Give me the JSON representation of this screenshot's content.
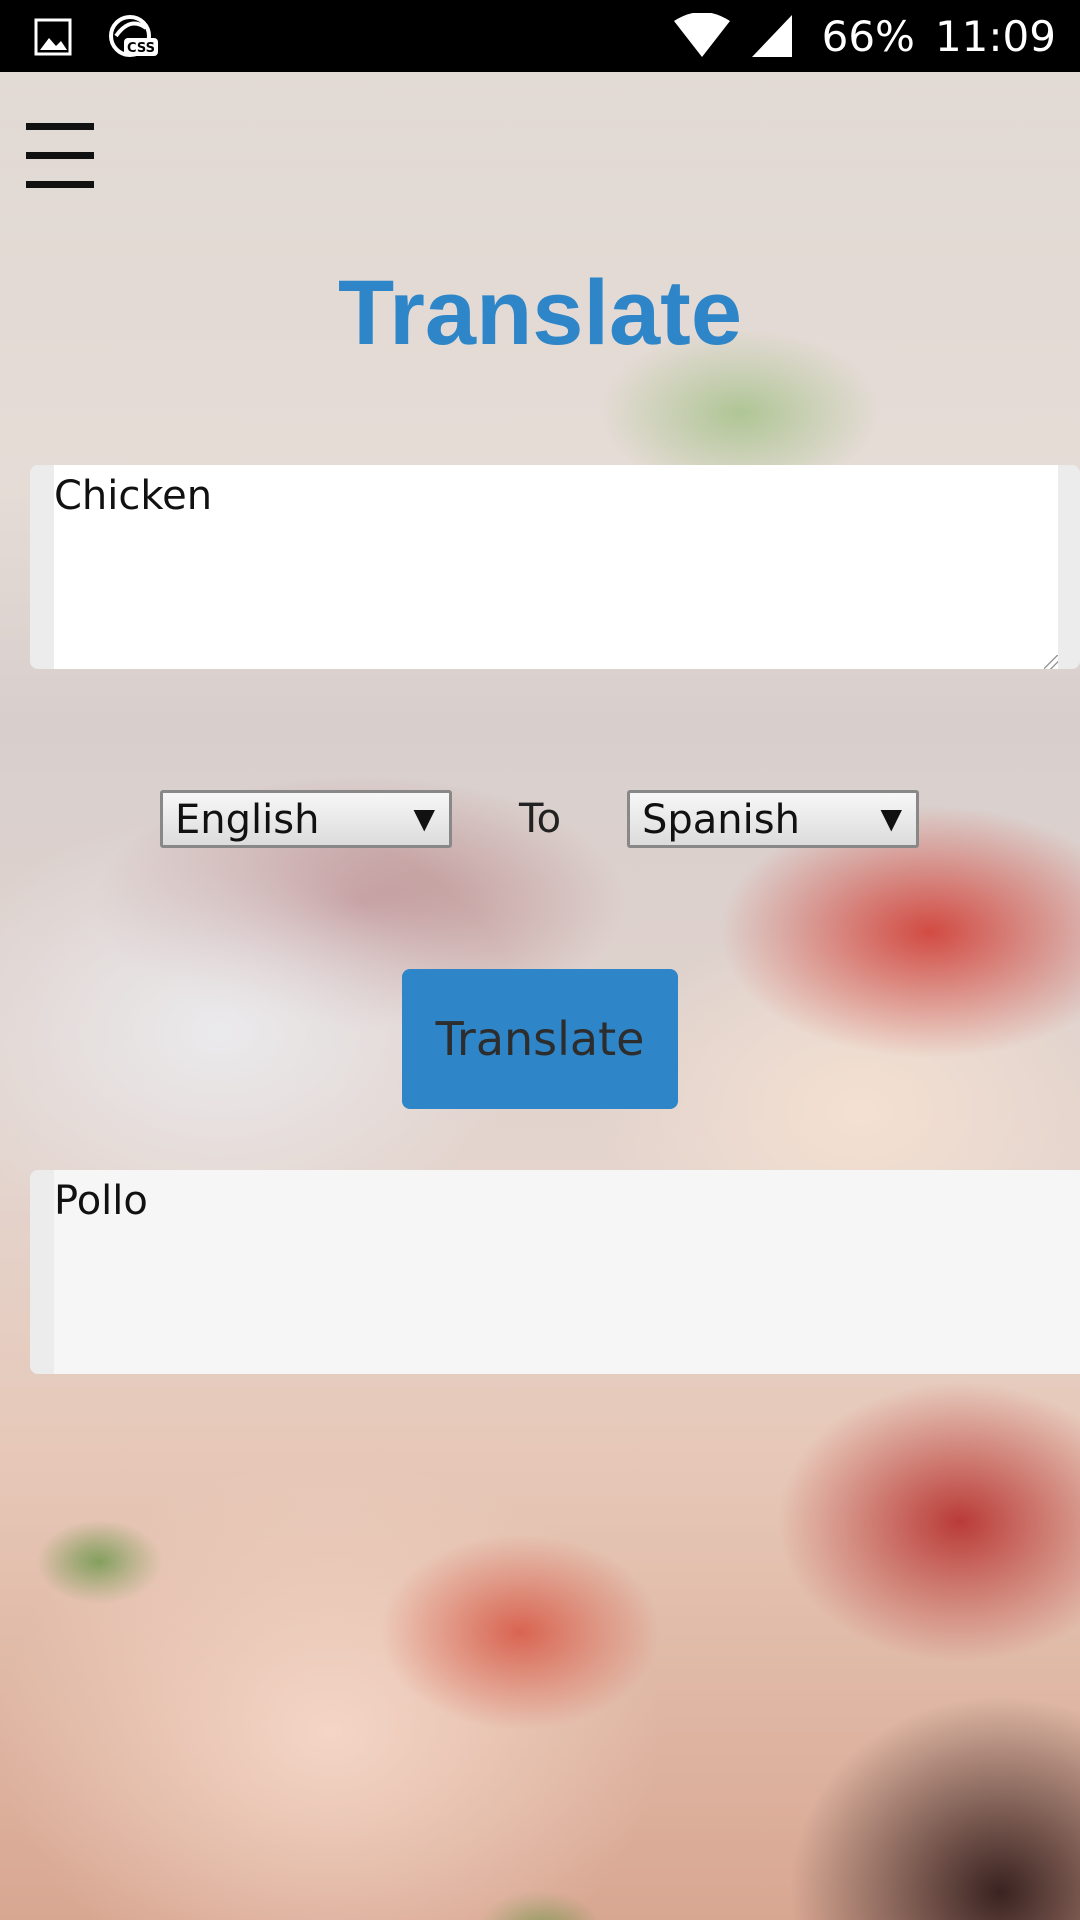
{
  "status_bar": {
    "battery": "66%",
    "time": "11:09",
    "icons": [
      "image-icon",
      "css-icon",
      "wifi-icon",
      "signal-icon"
    ]
  },
  "header": {
    "menu_icon": "hamburger-menu-icon",
    "title": "Translate"
  },
  "source": {
    "text": "Chicken"
  },
  "languages": {
    "from": "English",
    "separator": "To",
    "to": "Spanish"
  },
  "action": {
    "label": "Translate"
  },
  "result": {
    "text": "Pollo"
  },
  "colors": {
    "accent": "#2e86c8",
    "status_bar": "#000000"
  }
}
